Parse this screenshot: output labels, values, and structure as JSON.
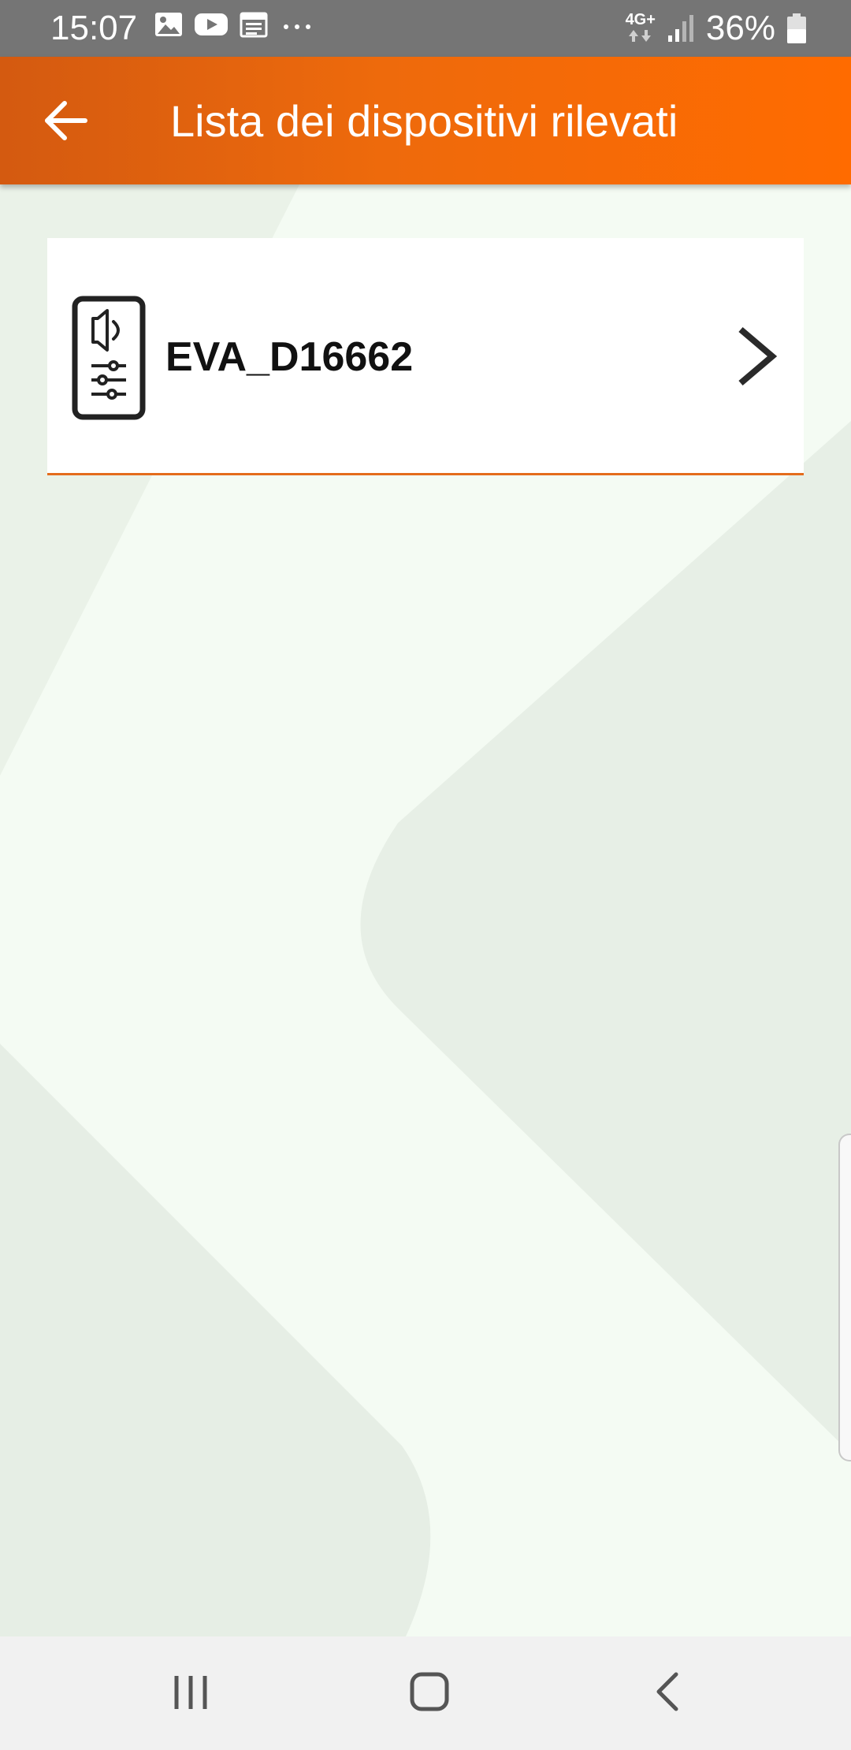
{
  "status_bar": {
    "time": "15:07",
    "left_icons": [
      "image-icon",
      "youtube-icon",
      "calendar-icon",
      "more-dots-icon"
    ],
    "network": "4G+",
    "battery": "36%"
  },
  "app_bar": {
    "back_icon": "arrow-left-icon",
    "title": "Lista dei dispositivi rilevati"
  },
  "devices": [
    {
      "name": "EVA_D16662",
      "icon": "device-settings-icon",
      "action_icon": "chevron-right-icon"
    }
  ],
  "colors": {
    "accent": "#ee6a0c",
    "accent_dark": "#d45a10",
    "status_bar": "#757575",
    "background": "#f4fbf3",
    "shape": "#e6eee5"
  },
  "nav_bar": {
    "buttons": [
      "recent-apps-icon",
      "home-icon",
      "back-icon"
    ]
  }
}
